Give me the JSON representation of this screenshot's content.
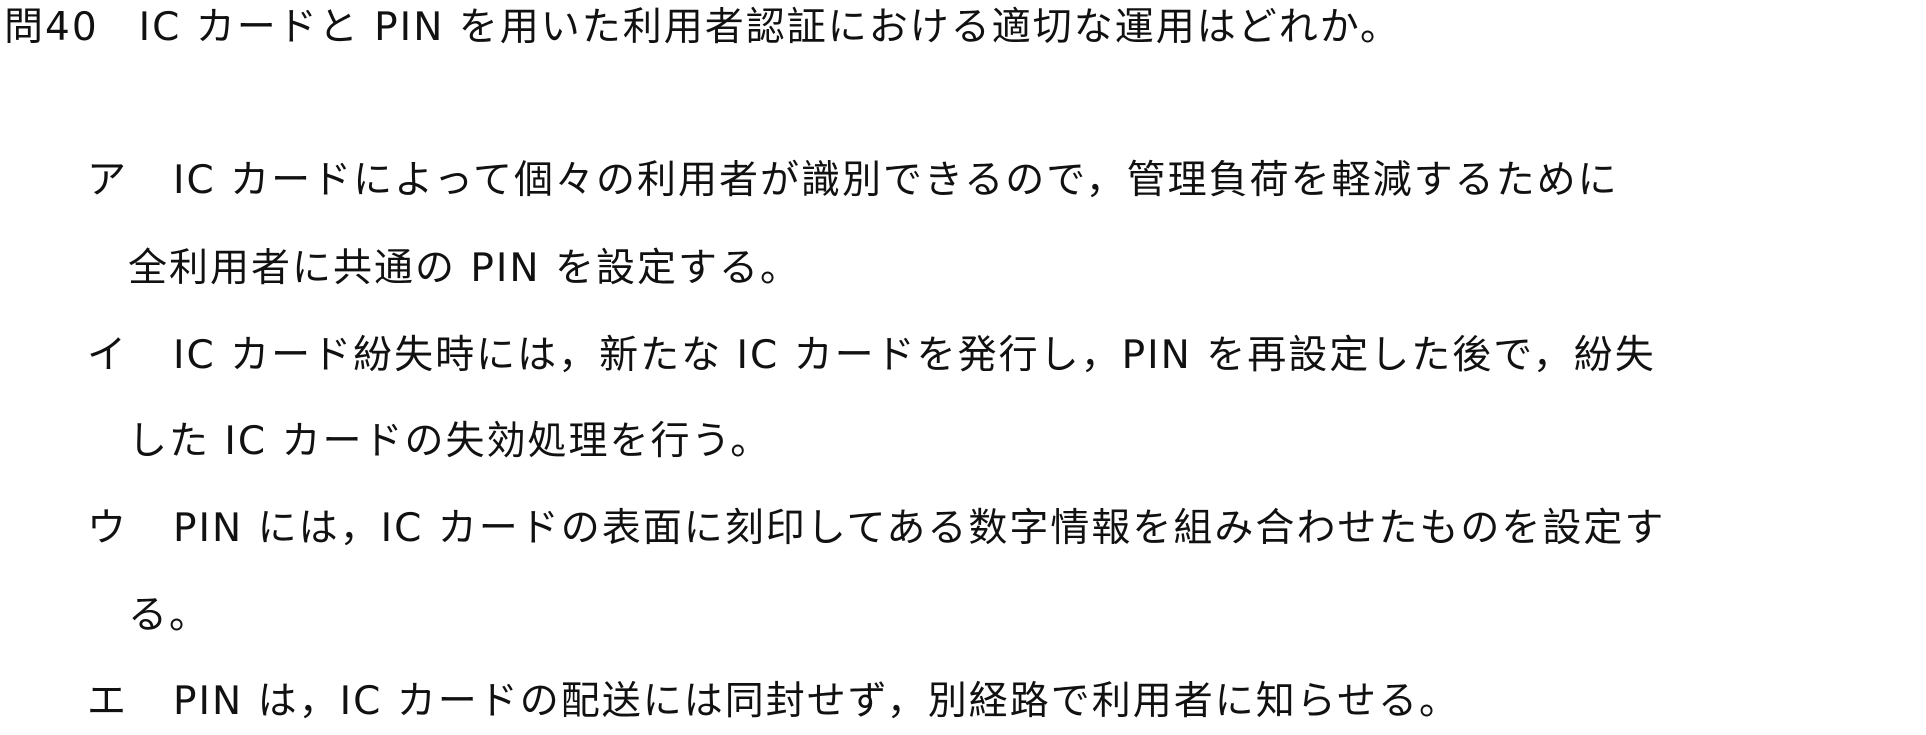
{
  "question": {
    "number": "問40",
    "text": "IC カードと PIN を用いた利用者認証における適切な運用はどれか。"
  },
  "options": [
    {
      "mark": "ア",
      "line1": "IC カードによって個々の利用者が識別できるので，管理負荷を軽減するために",
      "line2": "全利用者に共通の PIN を設定する。"
    },
    {
      "mark": "イ",
      "line1": "IC カード紛失時には，新たな IC カードを発行し，PIN を再設定した後で，紛失",
      "line2": "した IC カードの失効処理を行う。"
    },
    {
      "mark": "ウ",
      "line1": "PIN には，IC カードの表面に刻印してある数字情報を組み合わせたものを設定す",
      "line2": "る。"
    },
    {
      "mark": "エ",
      "line1": "PIN は，IC カードの配送には同封せず，別経路で利用者に知らせる。"
    }
  ]
}
